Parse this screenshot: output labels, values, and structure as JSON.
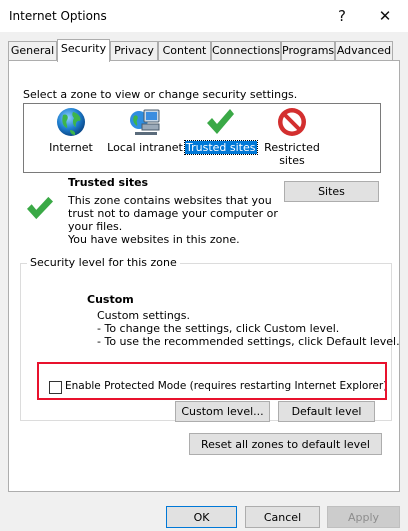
{
  "window": {
    "title": "Internet Options",
    "help_glyph": "?",
    "close_glyph": "✕"
  },
  "tabs": [
    {
      "label": "General",
      "active": false
    },
    {
      "label": "Security",
      "active": true
    },
    {
      "label": "Privacy",
      "active": false
    },
    {
      "label": "Content",
      "active": false
    },
    {
      "label": "Connections",
      "active": false
    },
    {
      "label": "Programs",
      "active": false
    },
    {
      "label": "Advanced",
      "active": false
    }
  ],
  "security": {
    "select_zone_prompt": "Select a zone to view or change security settings.",
    "zones": [
      {
        "label": "Internet",
        "icon": "globe-icon",
        "selected": false
      },
      {
        "label": "Local intranet",
        "icon": "intranet-icon",
        "selected": false
      },
      {
        "label": "Trusted sites",
        "icon": "checkmark-icon",
        "selected": true
      },
      {
        "label": "Restricted sites",
        "icon": "restricted-icon",
        "selected": false
      }
    ],
    "zone_info": {
      "title": "Trusted sites",
      "desc_line1": "This zone contains websites that you",
      "desc_line2": "trust not to damage your computer or",
      "desc_line3": "your files.",
      "desc_line4": "You have websites in this zone.",
      "sites_button": "Sites"
    },
    "level": {
      "group_title": "Security level for this zone",
      "name": "Custom",
      "line1": "Custom settings.",
      "line2": "- To change the settings, click Custom level.",
      "line3": "- To use the recommended settings, click Default level."
    },
    "protected_mode": {
      "label": "Enable Protected Mode (requires restarting Internet Explorer)",
      "checked": false
    },
    "custom_level_button": "Custom level...",
    "default_level_button": "Default level",
    "reset_all_button": "Reset all zones to default level"
  },
  "footer": {
    "ok": "OK",
    "cancel": "Cancel",
    "apply": "Apply"
  },
  "colors": {
    "selection": "#0078d7",
    "highlight_box": "#e8112d",
    "check_green": "#3aa946",
    "restricted_red": "#d32f2f"
  }
}
